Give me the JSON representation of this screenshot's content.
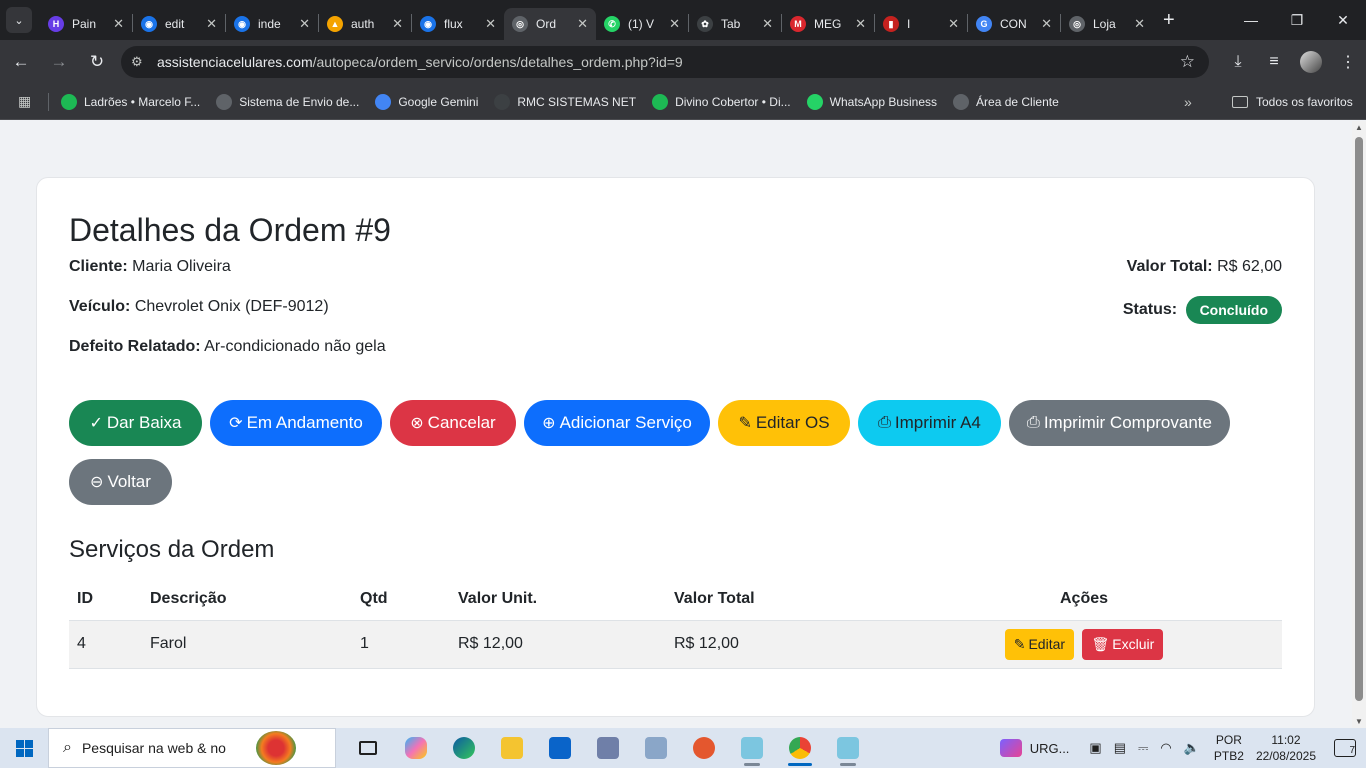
{
  "browser": {
    "tabs": [
      {
        "title": "Pain",
        "icon": "hostinger-icon",
        "color": "#673de6",
        "glyph": "H"
      },
      {
        "title": "edit",
        "icon": "globe-blue-icon",
        "color": "#1a73e8",
        "glyph": "◉"
      },
      {
        "title": "inde",
        "icon": "globe-blue-icon",
        "color": "#1a73e8",
        "glyph": "◉"
      },
      {
        "title": "auth",
        "icon": "stats-icon",
        "color": "#f4a300",
        "glyph": "▲"
      },
      {
        "title": "flux",
        "icon": "globe-blue-icon",
        "color": "#1a73e8",
        "glyph": "◉"
      },
      {
        "title": "Ord",
        "icon": "globe-icon",
        "color": "#5f6368",
        "glyph": "◎"
      },
      {
        "title": "(1) V",
        "icon": "whatsapp-icon",
        "color": "#25d366",
        "glyph": "✆"
      },
      {
        "title": "Tab",
        "icon": "openai-icon",
        "color": "#3c4043",
        "glyph": "✿"
      },
      {
        "title": "MEG",
        "icon": "mega-icon",
        "color": "#d9272e",
        "glyph": "M"
      },
      {
        "title": "I",
        "icon": "bookmark-red-icon",
        "color": "#c5221f",
        "glyph": "▮"
      },
      {
        "title": "CON",
        "icon": "google-icon",
        "color": "#4285f4",
        "glyph": "G"
      },
      {
        "title": "Loja",
        "icon": "globe-icon",
        "color": "#5f6368",
        "glyph": "◎"
      }
    ],
    "active_tab": 5,
    "url_host": "assistenciacelulares.com",
    "url_path": "/autopeca/ordem_servico/ordens/detalhes_ordem.php?id=9",
    "bookmarks": [
      {
        "label": "Ladrões • Marcelo F...",
        "icon": "spotify-icon",
        "color": "#1db954"
      },
      {
        "label": "Sistema de Envio de...",
        "icon": "globe-icon",
        "color": "#5f6368"
      },
      {
        "label": "Google Gemini",
        "icon": "gemini-icon",
        "color": "#4285f4"
      },
      {
        "label": "RMC SISTEMAS NET",
        "icon": "rmc-icon",
        "color": "#3c4043"
      },
      {
        "label": "Divino Cobertor • Di...",
        "icon": "spotify-icon",
        "color": "#1db954"
      },
      {
        "label": "WhatsApp Business",
        "icon": "whatsapp-icon",
        "color": "#25d366"
      },
      {
        "label": "Área de Cliente",
        "icon": "globe-icon",
        "color": "#5f6368"
      }
    ],
    "all_bookmarks_label": "Todos os favoritos"
  },
  "order": {
    "title": "Detalhes da Ordem #9",
    "client_label": "Cliente:",
    "client": "Maria Oliveira",
    "vehicle_label": "Veículo:",
    "vehicle": "Chevrolet Onix (DEF-9012)",
    "defect_label": "Defeito Relatado:",
    "defect": "Ar-condicionado não gela",
    "total_label": "Valor Total:",
    "total": "R$ 62,00",
    "status_label": "Status:",
    "status": "Concluído",
    "status_color": "#198754"
  },
  "actions": {
    "dar_baixa": "Dar Baixa",
    "em_andamento": "Em Andamento",
    "cancelar": "Cancelar",
    "adicionar_servico": "Adicionar Serviço",
    "editar_os": "Editar OS",
    "imprimir_a4": "Imprimir A4",
    "imprimir_comprovante": "Imprimir Comprovante",
    "voltar": "Voltar"
  },
  "services": {
    "title": "Serviços da Ordem",
    "headers": [
      "ID",
      "Descrição",
      "Qtd",
      "Valor Unit.",
      "Valor Total",
      "Ações"
    ],
    "rows": [
      {
        "id": "4",
        "descricao": "Farol",
        "qtd": "1",
        "valor_unit": "R$ 12,00",
        "valor_total": "R$ 12,00",
        "edit_label": "Editar",
        "delete_label": "Excluir"
      }
    ]
  },
  "taskbar": {
    "search_placeholder": "Pesquisar na web & no",
    "tray_app": "URG...",
    "lang_top": "POR",
    "lang_bottom": "PTB2",
    "time": "11:02",
    "date": "22/08/2025",
    "notifications": "7"
  }
}
